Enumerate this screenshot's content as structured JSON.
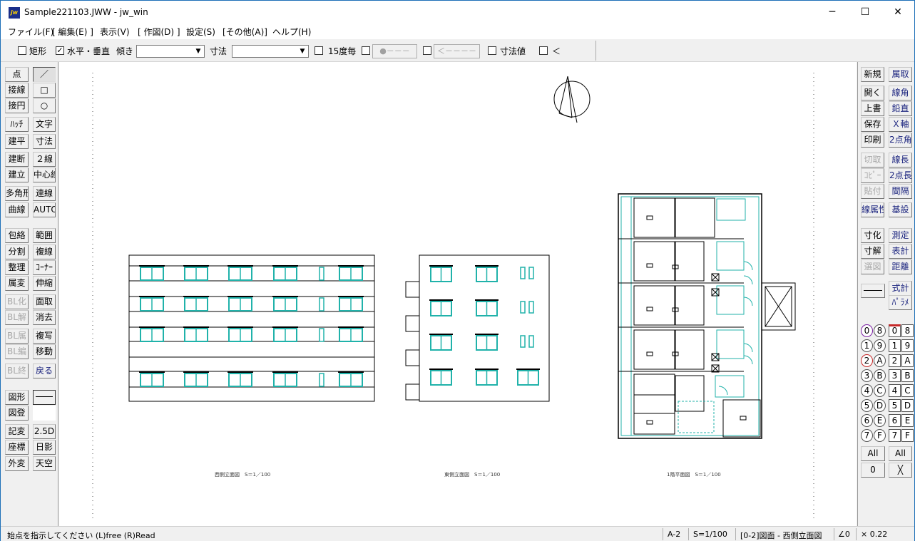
{
  "window": {
    "title": "Sample221103.JWW - jw_win",
    "app_icon": "jw",
    "minimize_icon": "─",
    "maximize_icon": "☐",
    "close_icon": "✕"
  },
  "menu": [
    "ファイル(F)",
    "[ 編集(E) ]",
    "表示(V)",
    "[ 作図(D) ]",
    "設定(S)",
    "[その他(A)]",
    "ヘルプ(H)"
  ],
  "toolbar": {
    "rect": {
      "label": "矩形",
      "checked": false
    },
    "hv": {
      "label": "水平・垂直",
      "checked": true
    },
    "slope_label": "傾き",
    "slope_value": "",
    "dim_label": "寸法",
    "dim_value": "",
    "deg15": {
      "label": "15度毎",
      "checked": false
    },
    "btn1": "●－－－",
    "btn2": "＜－－－－",
    "dimval": {
      "label": "寸法値",
      "checked": false
    },
    "lt": {
      "label": "＜",
      "checked": false
    },
    "check_mark": "✓"
  },
  "left_tools": [
    [
      "点",
      "／"
    ],
    [
      "接線",
      "□"
    ],
    [
      "接円",
      "○"
    ],
    [
      "ﾊｯﾁ",
      "文字"
    ],
    [
      "建平",
      "寸法"
    ],
    [
      "建断",
      "２線"
    ],
    [
      "建立",
      "中心線"
    ],
    [
      "多角形",
      "連線"
    ],
    [
      "曲線",
      "AUTO"
    ],
    [
      "包絡",
      "範囲"
    ],
    [
      "分割",
      "複線"
    ],
    [
      "整理",
      "ｺｰﾅｰ"
    ],
    [
      "属変",
      "伸縮"
    ],
    [
      "BL化",
      "面取"
    ],
    [
      "BL解",
      "消去"
    ],
    [
      "BL属",
      "複写"
    ],
    [
      "BL編",
      "移動"
    ],
    [
      "BL終",
      "戻る"
    ],
    [
      "図形",
      ""
    ],
    [
      "図登",
      ""
    ],
    [
      "記変",
      "2.5D"
    ],
    [
      "座標",
      "日影"
    ],
    [
      "外変",
      "天空"
    ]
  ],
  "right_tools": [
    [
      "新規",
      "属取"
    ],
    [
      "開く",
      "線角"
    ],
    [
      "上書",
      "鉛直"
    ],
    [
      "保存",
      "Ｘ軸"
    ],
    [
      "印刷",
      "2点角"
    ],
    [
      "切取",
      "線長"
    ],
    [
      "ｺﾋﾟｰ",
      "2点長"
    ],
    [
      "貼付",
      "間隔"
    ],
    [
      "線属性",
      "基設"
    ],
    [
      "寸化",
      "測定"
    ],
    [
      "寸解",
      "表計"
    ],
    [
      "選図",
      "距離"
    ],
    [
      "",
      "式計"
    ],
    [
      "",
      "ﾊﾟﾗﾒ"
    ]
  ],
  "layer_groups": [
    [
      "0",
      "8"
    ],
    [
      "1",
      "9"
    ],
    [
      "2",
      "A"
    ],
    [
      "3",
      "B"
    ],
    [
      "4",
      "C"
    ],
    [
      "5",
      "D"
    ],
    [
      "6",
      "E"
    ],
    [
      "7",
      "F"
    ]
  ],
  "layers": [
    [
      "0",
      "8"
    ],
    [
      "1",
      "9"
    ],
    [
      "2",
      "A"
    ],
    [
      "3",
      "B"
    ],
    [
      "4",
      "C"
    ],
    [
      "5",
      "D"
    ],
    [
      "6",
      "E"
    ],
    [
      "7",
      "F"
    ]
  ],
  "layer_bottom": {
    "all_left": "All",
    "all_right": "All",
    "zero": "0",
    "x": "╳"
  },
  "drawing": {
    "label1": "西側立面図　S＝1／100",
    "label2": "東側立面図　S＝1／100",
    "label3": "1階平面図　S＝1／100",
    "window_color": "#20b2aa",
    "line_color": "#000000"
  },
  "status": {
    "message": "始点を指示してください (L)free (R)Read",
    "paper": "A-2",
    "scale": "S=1/100",
    "layer": "[0-2]図面 - 西側立面図",
    "angle": "∠0",
    "factor": "× 0.22"
  }
}
